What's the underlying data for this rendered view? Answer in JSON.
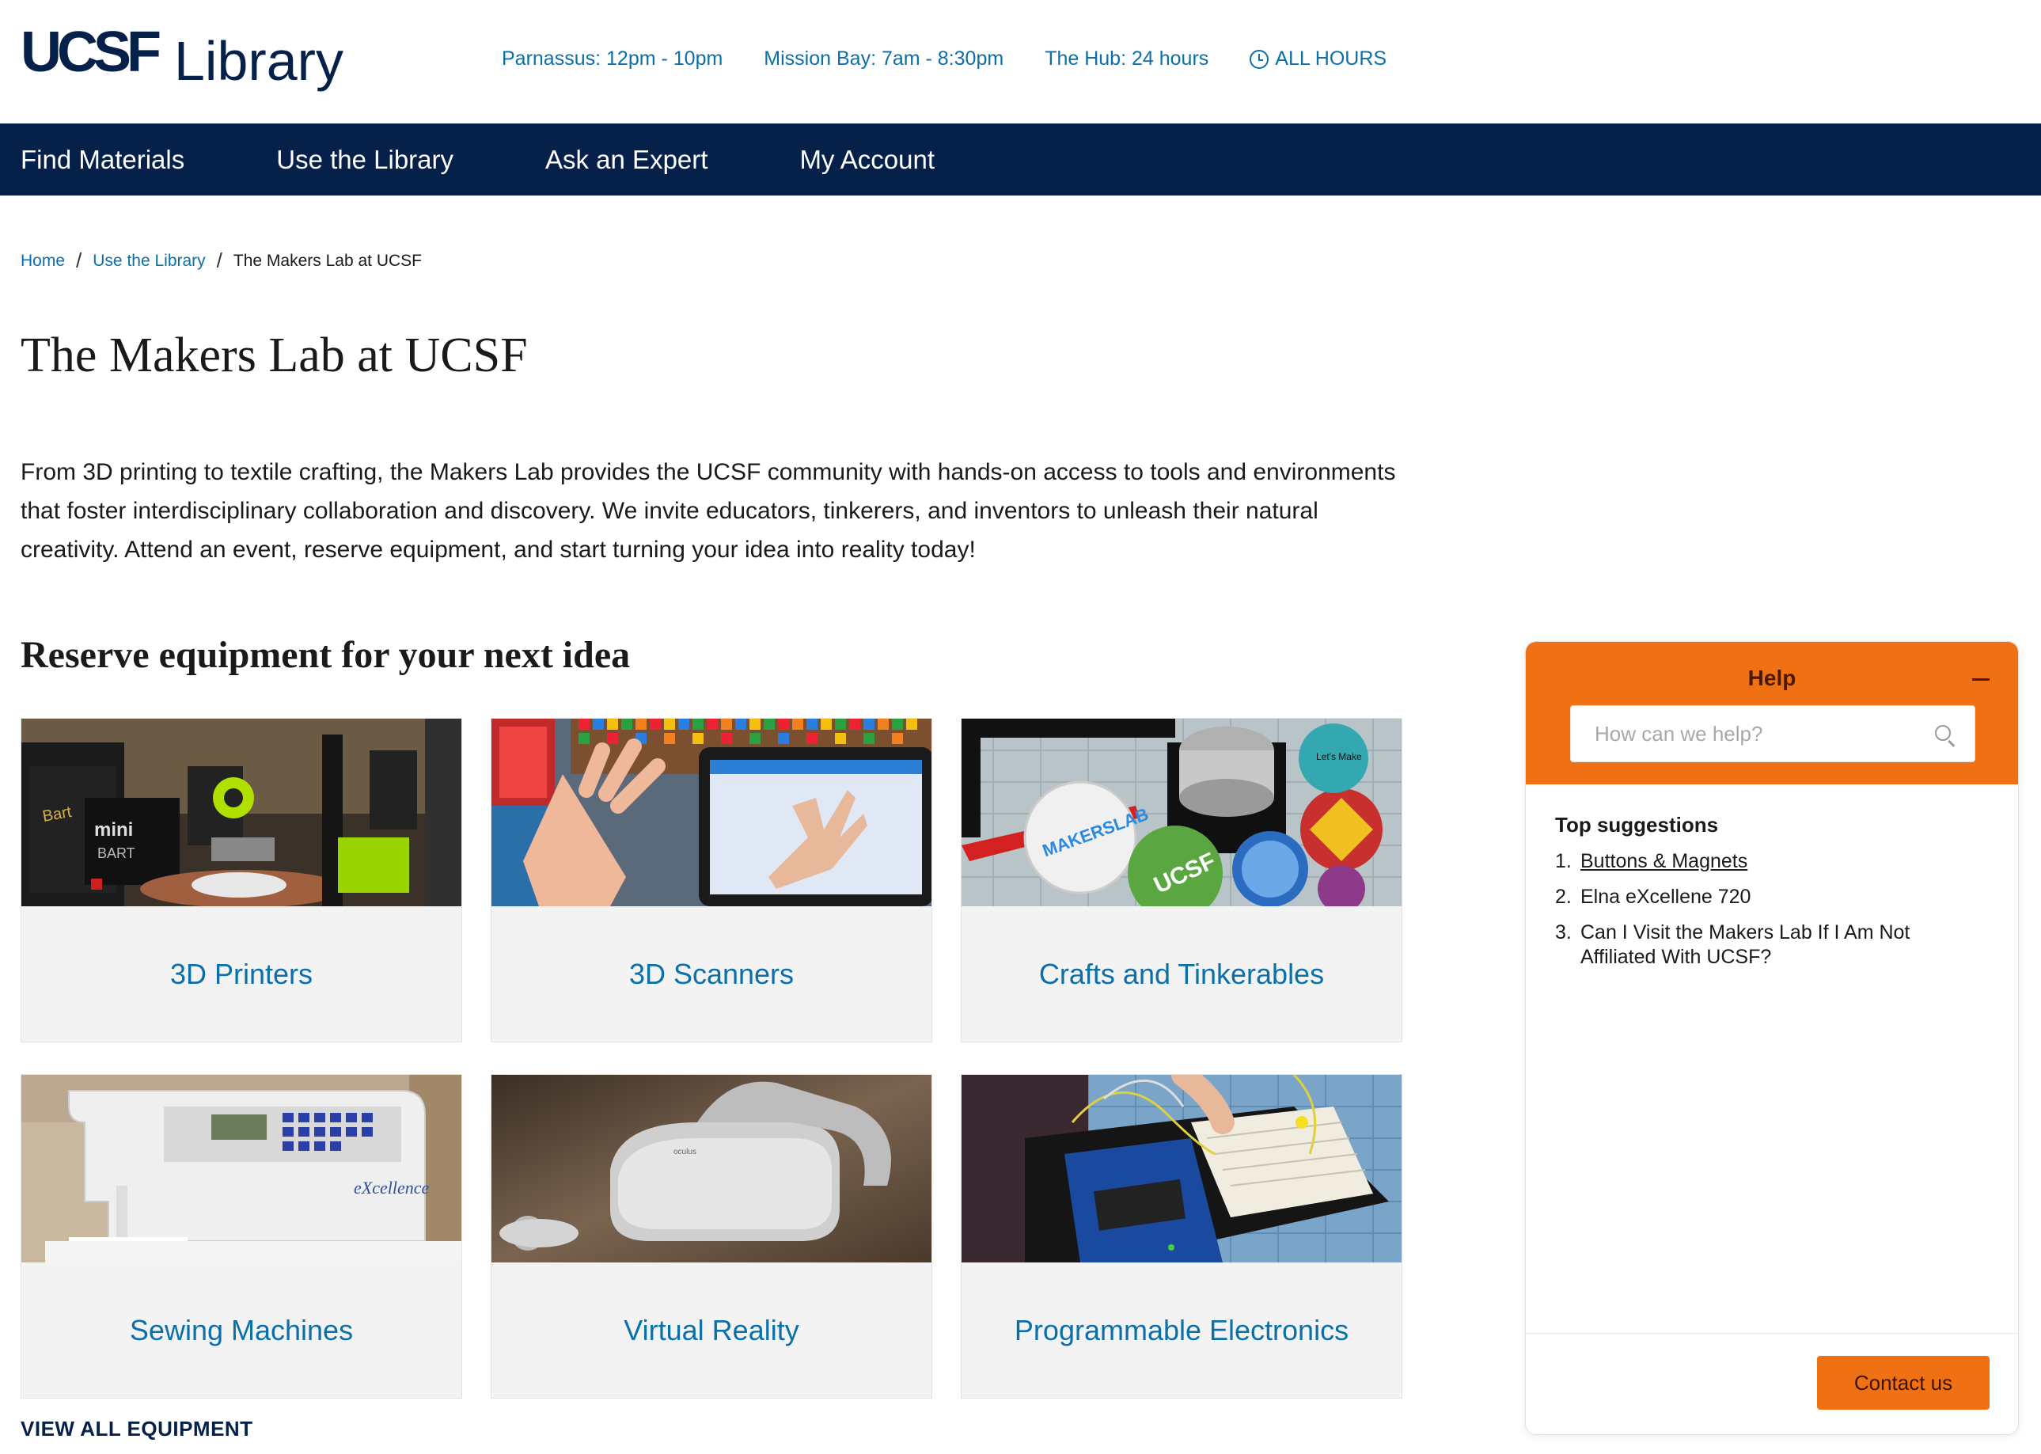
{
  "header": {
    "logo_mark": "UCSF",
    "logo_text": "Library",
    "hours": [
      {
        "label": "Parnassus: 12pm - 10pm"
      },
      {
        "label": "Mission Bay: 7am - 8:30pm"
      },
      {
        "label": "The Hub: 24 hours"
      }
    ],
    "all_hours_label": "ALL HOURS",
    "all_hours_icon": "clock-icon"
  },
  "nav": {
    "items": [
      {
        "label": "Find Materials"
      },
      {
        "label": "Use the Library"
      },
      {
        "label": "Ask an Expert"
      },
      {
        "label": "My Account"
      }
    ]
  },
  "breadcrumb": {
    "items": [
      "Home",
      "Use the Library"
    ],
    "current": "The Makers Lab at UCSF"
  },
  "page": {
    "title": "The Makers Lab at UCSF",
    "intro": "From 3D printing to textile crafting, the Makers Lab provides the UCSF community with hands-on access to tools and environments that foster interdisciplinary collaboration and discovery. We invite educators, tinkerers, and inventors to unleash their natural creativity. Attend an event, reserve equipment, and start turning your idea into reality today!",
    "section_title": "Reserve equipment for your next idea",
    "view_all": "VIEW ALL EQUIPMENT"
  },
  "cards": [
    {
      "label": "3D Printers"
    },
    {
      "label": "3D Scanners"
    },
    {
      "label": "Crafts and Tinkerables"
    },
    {
      "label": "Sewing Machines"
    },
    {
      "label": "Virtual Reality"
    },
    {
      "label": "Programmable Electronics"
    }
  ],
  "help": {
    "title": "Help",
    "search_placeholder": "How can we help?",
    "suggestions_title": "Top suggestions",
    "suggestions": [
      {
        "num": "1.",
        "text": "Buttons & Magnets"
      },
      {
        "num": "2.",
        "text": "Elna eXcellene 720"
      },
      {
        "num": "3.",
        "text": "Can I Visit the Makers Lab If I Am Not Affiliated With UCSF?"
      }
    ],
    "contact_label": "Contact us"
  },
  "colors": {
    "navy": "#052049",
    "link": "#0b6fa8",
    "orange": "#f07014"
  }
}
